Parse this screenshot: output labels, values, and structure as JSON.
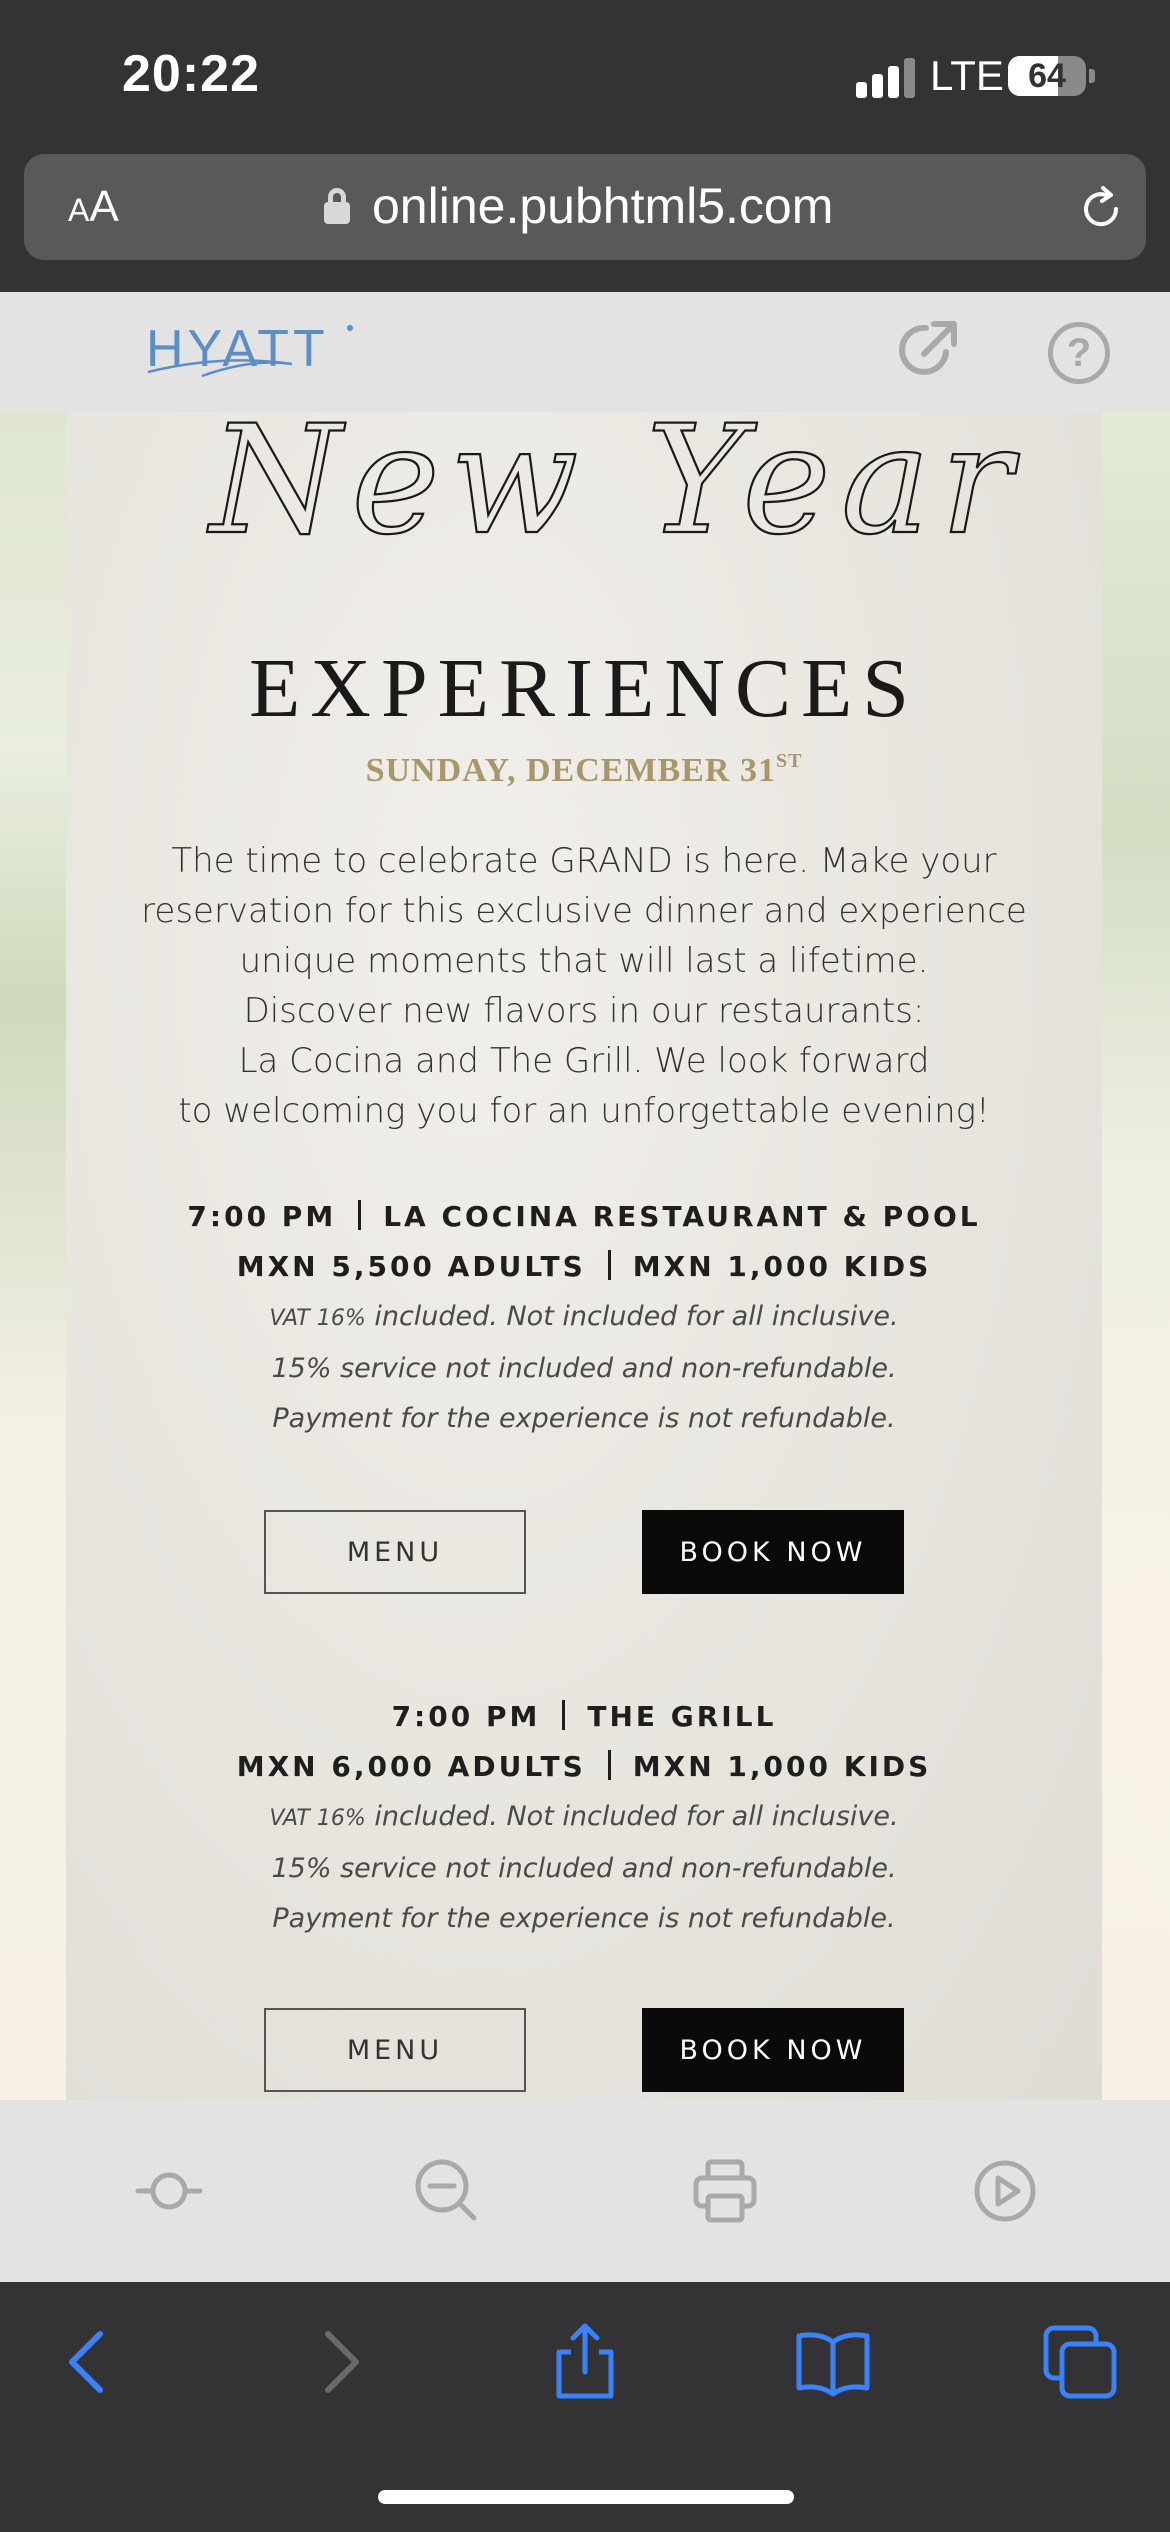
{
  "status_bar": {
    "time": "20:22",
    "network": "LTE",
    "battery_level": "64",
    "battery_fraction": 0.64
  },
  "address_bar": {
    "aa_label_small": "A",
    "aa_label_large": "A",
    "url": "online.pubhtml5.com"
  },
  "viewer_header": {
    "logo_text": "HYATT"
  },
  "flyer": {
    "script_title": "New Year",
    "headline": "EXPERIENCES",
    "date_text": "SUNDAY, DECEMBER 31",
    "date_suffix": "ST",
    "intro_lines": [
      "The time to celebrate GRAND is here. Make your",
      "reservation for this exclusive dinner and experience",
      "unique moments that will last a lifetime.",
      "Discover new flavors in our restaurants:",
      "La Cocina and The Grill. We look forward",
      "to welcoming you for an unforgettable evening!"
    ],
    "events": [
      {
        "time": "7:00 PM",
        "venue": "LA COCINA RESTAURANT & POOL",
        "adult_price": "MXN 5,500 ADULTS",
        "kids_price": "MXN 1,000 KIDS",
        "note_vat_prefix": "VAT 16%",
        "note_vat_rest": " included. Not included for all inclusive.",
        "note_service": "15% service not included and non-refundable.",
        "note_payment": "Payment for the experience is not refundable.",
        "menu_label": "MENU",
        "book_label": "BOOK NOW"
      },
      {
        "time": "7:00 PM",
        "venue": "THE GRILL",
        "adult_price": "MXN 6,000 ADULTS",
        "kids_price": "MXN 1,000 KIDS",
        "note_vat_prefix": "VAT 16%",
        "note_vat_rest": " included. Not included for all inclusive.",
        "note_service": "15% service not included and non-refundable.",
        "note_payment": "Payment for the experience is not refundable.",
        "menu_label": "MENU",
        "book_label": "BOOK NOW"
      }
    ]
  },
  "viewer_controls": [
    "fit-page-icon",
    "zoom-out-icon",
    "print-icon",
    "autoplay-icon"
  ],
  "safari_nav": [
    "back-icon",
    "forward-icon",
    "share-icon",
    "bookmarks-icon",
    "tabs-icon"
  ],
  "colors": {
    "safari_blue": "#3a82f7",
    "date_gold": "#a8976a",
    "hyatt_blue": "#5b8ec9"
  }
}
